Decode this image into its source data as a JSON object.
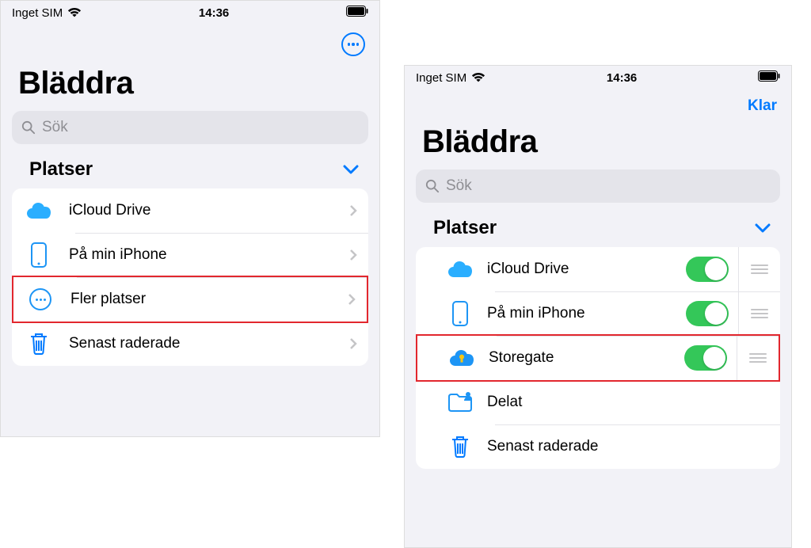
{
  "left": {
    "status": {
      "carrier": "Inget SIM",
      "time": "14:36"
    },
    "title": "Bläddra",
    "search_placeholder": "Sök",
    "section_label": "Platser",
    "rows": {
      "icloud": "iCloud Drive",
      "iphone": "På min iPhone",
      "more_places": "Fler platser",
      "trash": "Senast raderade"
    }
  },
  "right": {
    "status": {
      "carrier": "Inget SIM",
      "time": "14:36"
    },
    "done_label": "Klar",
    "title": "Bläddra",
    "search_placeholder": "Sök",
    "section_label": "Platser",
    "rows": {
      "icloud": "iCloud Drive",
      "iphone": "På min iPhone",
      "storegate": "Storegate",
      "shared": "Delat",
      "trash": "Senast raderade"
    }
  }
}
